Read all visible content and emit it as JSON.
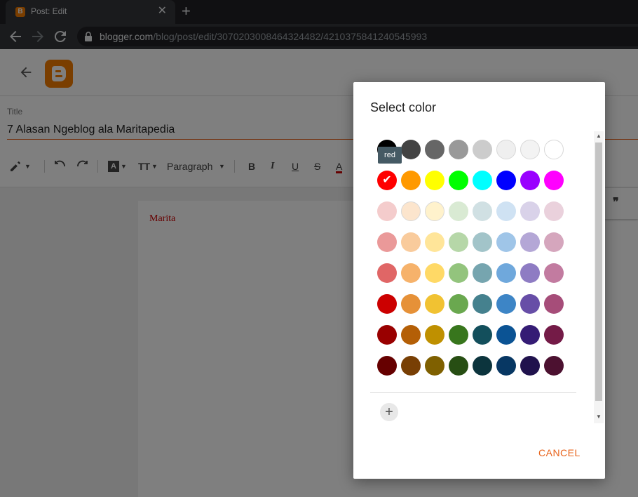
{
  "browser": {
    "tab_title": "Post: Edit",
    "tab_close": "✕",
    "new_tab": "+",
    "url_host": "blogger.com",
    "url_path": "/blog/post/edit/3070203008464324482/4210375841240545993"
  },
  "editor": {
    "title_label": "Title",
    "title_value": "7 Alasan Ngeblog ala Maritapedia",
    "body_text": "Marita",
    "toolbar": {
      "bold": "B",
      "italic": "I",
      "underline": "U",
      "strikethrough": "S",
      "text_color": "A",
      "highlight": "A",
      "font_size": "TT",
      "paragraph_format": "Paragraph",
      "quote": "❞"
    }
  },
  "dialog": {
    "title": "Select color",
    "tooltip": "red",
    "selected_color": "#ff0000",
    "cancel_label": "CANCEL",
    "add_label": "+",
    "check": "✔",
    "swatch_rows": [
      [
        "#000000",
        "#434343",
        "#666666",
        "#999999",
        "#cccccc",
        "#efefef",
        "#f3f3f3",
        "#ffffff"
      ],
      [
        "#ff0000",
        "#ff9900",
        "#ffff00",
        "#00ff00",
        "#00ffff",
        "#0000ff",
        "#9900ff",
        "#ff00ff"
      ],
      [
        "#f4cccc",
        "#fce5cd",
        "#fff2cc",
        "#d9ead3",
        "#d0e0e3",
        "#cfe2f3",
        "#d9d2e9",
        "#ead1dc"
      ],
      [
        "#ea9999",
        "#f9cb9c",
        "#ffe599",
        "#b6d7a8",
        "#a2c4c9",
        "#9fc5e8",
        "#b4a7d6",
        "#d5a6bd"
      ],
      [
        "#e06666",
        "#f6b26b",
        "#ffd966",
        "#93c47d",
        "#76a5af",
        "#6fa8dc",
        "#8e7cc3",
        "#c27ba0"
      ],
      [
        "#cc0000",
        "#e69138",
        "#f1c232",
        "#6aa84f",
        "#45818e",
        "#3d85c6",
        "#674ea7",
        "#a64d79"
      ],
      [
        "#990000",
        "#b45f06",
        "#bf9000",
        "#38761d",
        "#134f5c",
        "#0b5394",
        "#351c75",
        "#741b47"
      ],
      [
        "#660000",
        "#783f04",
        "#7f6000",
        "#274e13",
        "#0c343d",
        "#073763",
        "#20124d",
        "#4c1130"
      ]
    ]
  },
  "colors": {
    "accent": "#e8631b",
    "blogger_orange": "#f57d00",
    "tab_bg": "#35363a",
    "chrome_bg": "#202124"
  }
}
